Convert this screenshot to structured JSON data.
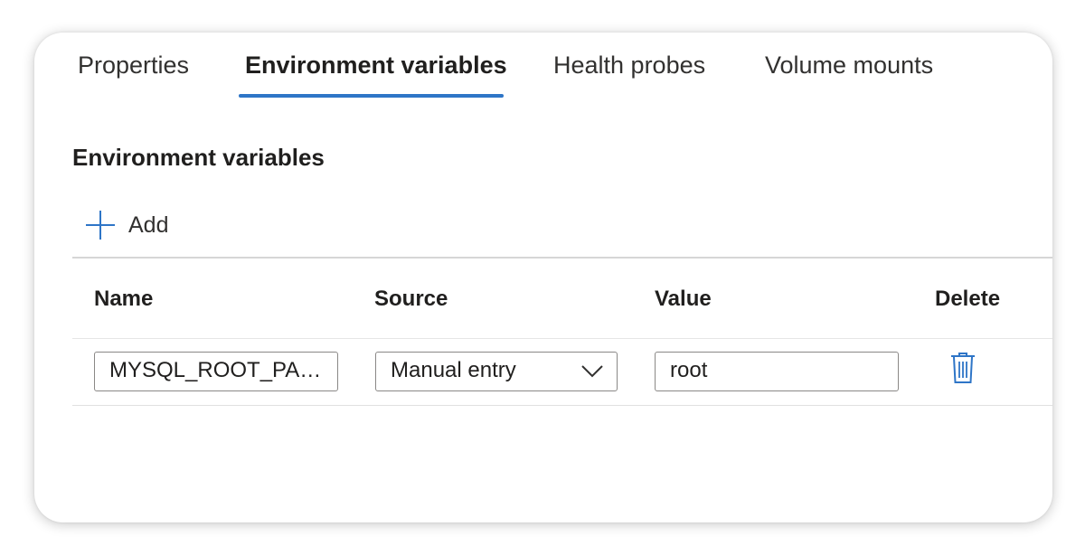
{
  "tabs": [
    {
      "label": "Properties",
      "active": false
    },
    {
      "label": "Environment variables",
      "active": true
    },
    {
      "label": "Health probes",
      "active": false
    },
    {
      "label": "Volume mounts",
      "active": false
    }
  ],
  "section": {
    "title": "Environment variables",
    "add_label": "Add",
    "add_icon": "plus-icon"
  },
  "table": {
    "headers": [
      "Name",
      "Source",
      "Value",
      "Delete"
    ],
    "rows": [
      {
        "name": "MYSQL_ROOT_PASSWORD",
        "name_display": "MYSQL_ROOT_PAS...",
        "source": "Manual entry",
        "value": "root",
        "delete_icon": "trash-icon"
      }
    ]
  },
  "colors": {
    "accent": "#2e75c7",
    "text": "#201f1e",
    "border": "#8a8886"
  }
}
